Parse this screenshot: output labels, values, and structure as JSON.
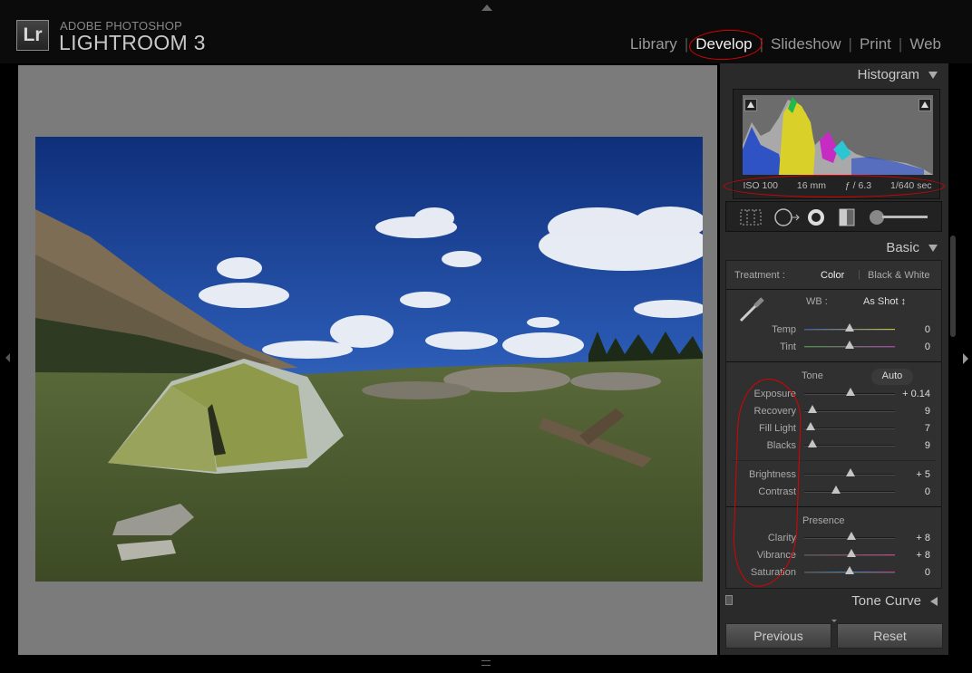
{
  "window": {
    "brand_small": "ADOBE PHOTOSHOP",
    "brand_main": "LIGHTROOM 3",
    "logo_text": "Lr"
  },
  "modules": {
    "library": "Library",
    "develop": "Develop",
    "slideshow": "Slideshow",
    "print": "Print",
    "web": "Web",
    "separator": "|",
    "active": "Develop"
  },
  "histogram": {
    "title": "Histogram",
    "iso": "ISO 100",
    "focal_length": "16 mm",
    "aperture": "ƒ / 6.3",
    "shutter": "1/640 sec"
  },
  "basic": {
    "title": "Basic",
    "treatment_label": "Treatment :",
    "treatment_color": "Color",
    "treatment_bw": "Black & White",
    "wb_label": "WB :",
    "wb_value": "As Shot ↕",
    "temp_label": "Temp",
    "temp_value": "0",
    "tint_label": "Tint",
    "tint_value": "0",
    "tone_label": "Tone",
    "auto_label": "Auto",
    "exposure_label": "Exposure",
    "exposure_value": "+ 0.14",
    "recovery_label": "Recovery",
    "recovery_value": "9",
    "fill_light_label": "Fill Light",
    "fill_light_value": "7",
    "blacks_label": "Blacks",
    "blacks_value": "9",
    "brightness_label": "Brightness",
    "brightness_value": "+ 5",
    "contrast_label": "Contrast",
    "contrast_value": "0",
    "presence_label": "Presence",
    "clarity_label": "Clarity",
    "clarity_value": "+ 8",
    "vibrance_label": "Vibrance",
    "vibrance_value": "+ 8",
    "saturation_label": "Saturation",
    "saturation_value": "0"
  },
  "slider_levels": {
    "temp": 0.5,
    "tint": 0.5,
    "exposure": 0.51,
    "recovery": 0.09,
    "fill_light": 0.07,
    "blacks": 0.09,
    "brightness": 0.51,
    "contrast": 0.35,
    "clarity": 0.52,
    "vibrance": 0.52,
    "saturation": 0.5
  },
  "tone_curve": {
    "title": "Tone Curve"
  },
  "buttons": {
    "previous": "Previous",
    "reset": "Reset"
  },
  "icons": {
    "logo": "lightroom-logo-icon",
    "crop": "crop-overlay-icon",
    "spot": "spot-removal-icon",
    "redeye": "red-eye-icon",
    "grad": "graduated-filter-icon",
    "brush": "adjustment-brush-icon"
  },
  "colors": {
    "annotation_red": "#d00000",
    "panel_bg": "#2a2a2a",
    "image_bg": "#7b7b7b"
  }
}
